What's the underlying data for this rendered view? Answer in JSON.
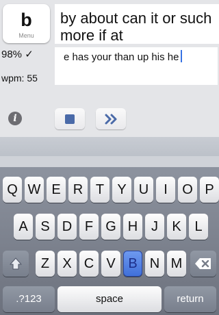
{
  "menu": {
    "letter": "b",
    "label": "Menu"
  },
  "stats": {
    "accuracy": "98% ✓",
    "wpm": "wpm: 55"
  },
  "target_text": "by about can it or such more if at",
  "typed_text": "e has your than up his he",
  "controls": {
    "info": "i",
    "stop": "stop-icon",
    "forward": "fast-forward-icon"
  },
  "keyboard": {
    "row1": [
      "Q",
      "W",
      "E",
      "R",
      "T",
      "Y",
      "U",
      "I",
      "O",
      "P"
    ],
    "row2": [
      "A",
      "S",
      "D",
      "F",
      "G",
      "H",
      "J",
      "K",
      "L"
    ],
    "row3": [
      "Z",
      "X",
      "C",
      "V",
      "B",
      "N",
      "M"
    ],
    "highlighted_key": "B",
    "shift_icon": "shift-icon",
    "delete_icon": "backspace-icon",
    "numbers_label": ".?123",
    "space_label": "space",
    "return_label": "return"
  },
  "colors": {
    "highlight": "#4f7fe3",
    "caret": "#3672e3",
    "control_icon": "#4a6aa8"
  }
}
